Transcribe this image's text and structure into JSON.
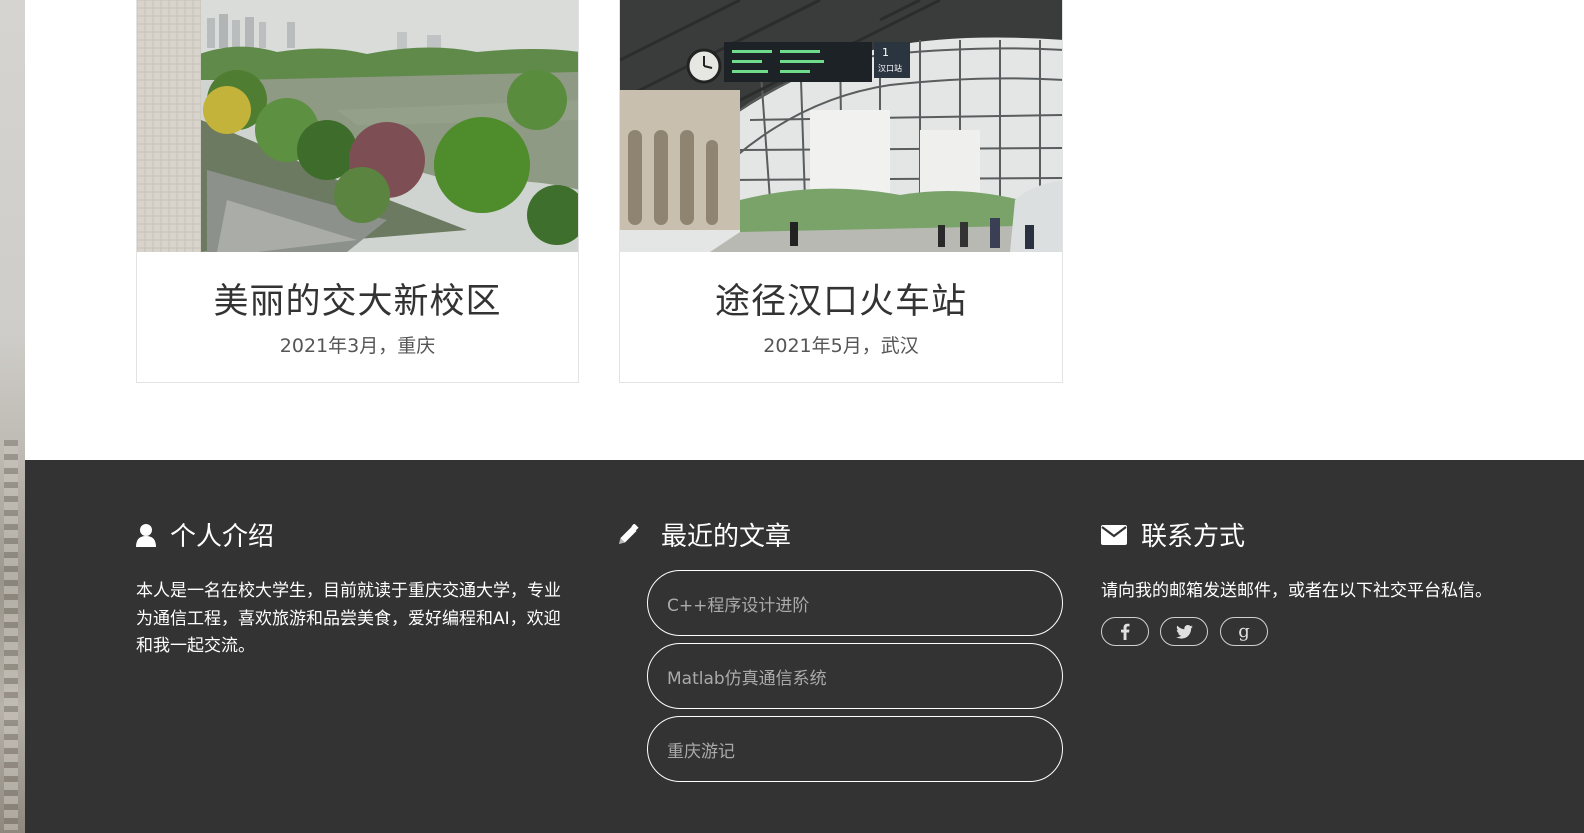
{
  "gallery": {
    "cards": [
      {
        "title": "美丽的交大新校区",
        "meta": "2021年3月，重庆",
        "image": "campus-lake-photo"
      },
      {
        "title": "途径汉口火车站",
        "meta": "2021年5月，武汉",
        "image": "hankou-station-photo"
      }
    ],
    "station_sign": "汉口站",
    "station_platform": "1"
  },
  "footer": {
    "about": {
      "icon": "user-icon",
      "heading": "个人介绍",
      "text": "本人是一名在校大学生，目前就读于重庆交通大学，专业为通信工程，喜欢旅游和品尝美食，爱好编程和AI，欢迎和我一起交流。"
    },
    "recent": {
      "icon": "pencil-icon",
      "heading": "最近的文章",
      "posts": [
        "C++程序设计进阶",
        "Matlab仿真通信系统",
        "重庆游记"
      ]
    },
    "contact": {
      "icon": "envelope-icon",
      "heading": "联系方式",
      "text": "请向我的邮箱发送邮件，或者在以下社交平台私信。",
      "socials": [
        {
          "icon": "facebook-icon",
          "glyph": "f"
        },
        {
          "icon": "twitter-icon",
          "glyph": "t"
        },
        {
          "icon": "google-plus-icon",
          "glyph": "g"
        }
      ]
    }
  },
  "colors": {
    "footer_bg": "#333333",
    "footer_text": "#ffffff",
    "post_text": "#aaaaaa",
    "card_title": "#333333"
  }
}
